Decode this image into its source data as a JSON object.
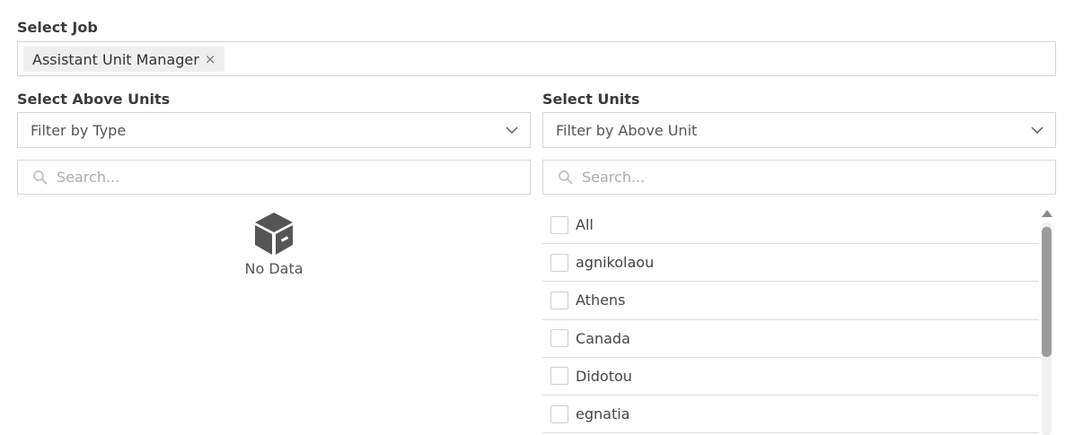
{
  "job": {
    "label": "Select Job",
    "selected_chip": "Assistant Unit Manager",
    "chip_remove": "×"
  },
  "above_units": {
    "label": "Select Above Units",
    "filter_value": "Filter by Type",
    "search_placeholder": "Search...",
    "empty_text": "No Data"
  },
  "units": {
    "label": "Select Units",
    "filter_value": "Filter by Above Unit",
    "search_placeholder": "Search...",
    "items": [
      {
        "label": "All",
        "checked": false
      },
      {
        "label": "agnikolaou",
        "checked": false
      },
      {
        "label": "Athens",
        "checked": false
      },
      {
        "label": "Canada",
        "checked": false
      },
      {
        "label": "Didotou",
        "checked": false
      },
      {
        "label": "egnatia",
        "checked": false
      }
    ]
  },
  "icons": {
    "chip_remove": "close-icon",
    "dropdown": "chevron-down-icon",
    "search": "search-icon",
    "empty": "box-icon"
  },
  "colors": {
    "border": "#d6d6d6",
    "chip_bg": "#efefef",
    "scroll_thumb": "#9b9b9b"
  }
}
